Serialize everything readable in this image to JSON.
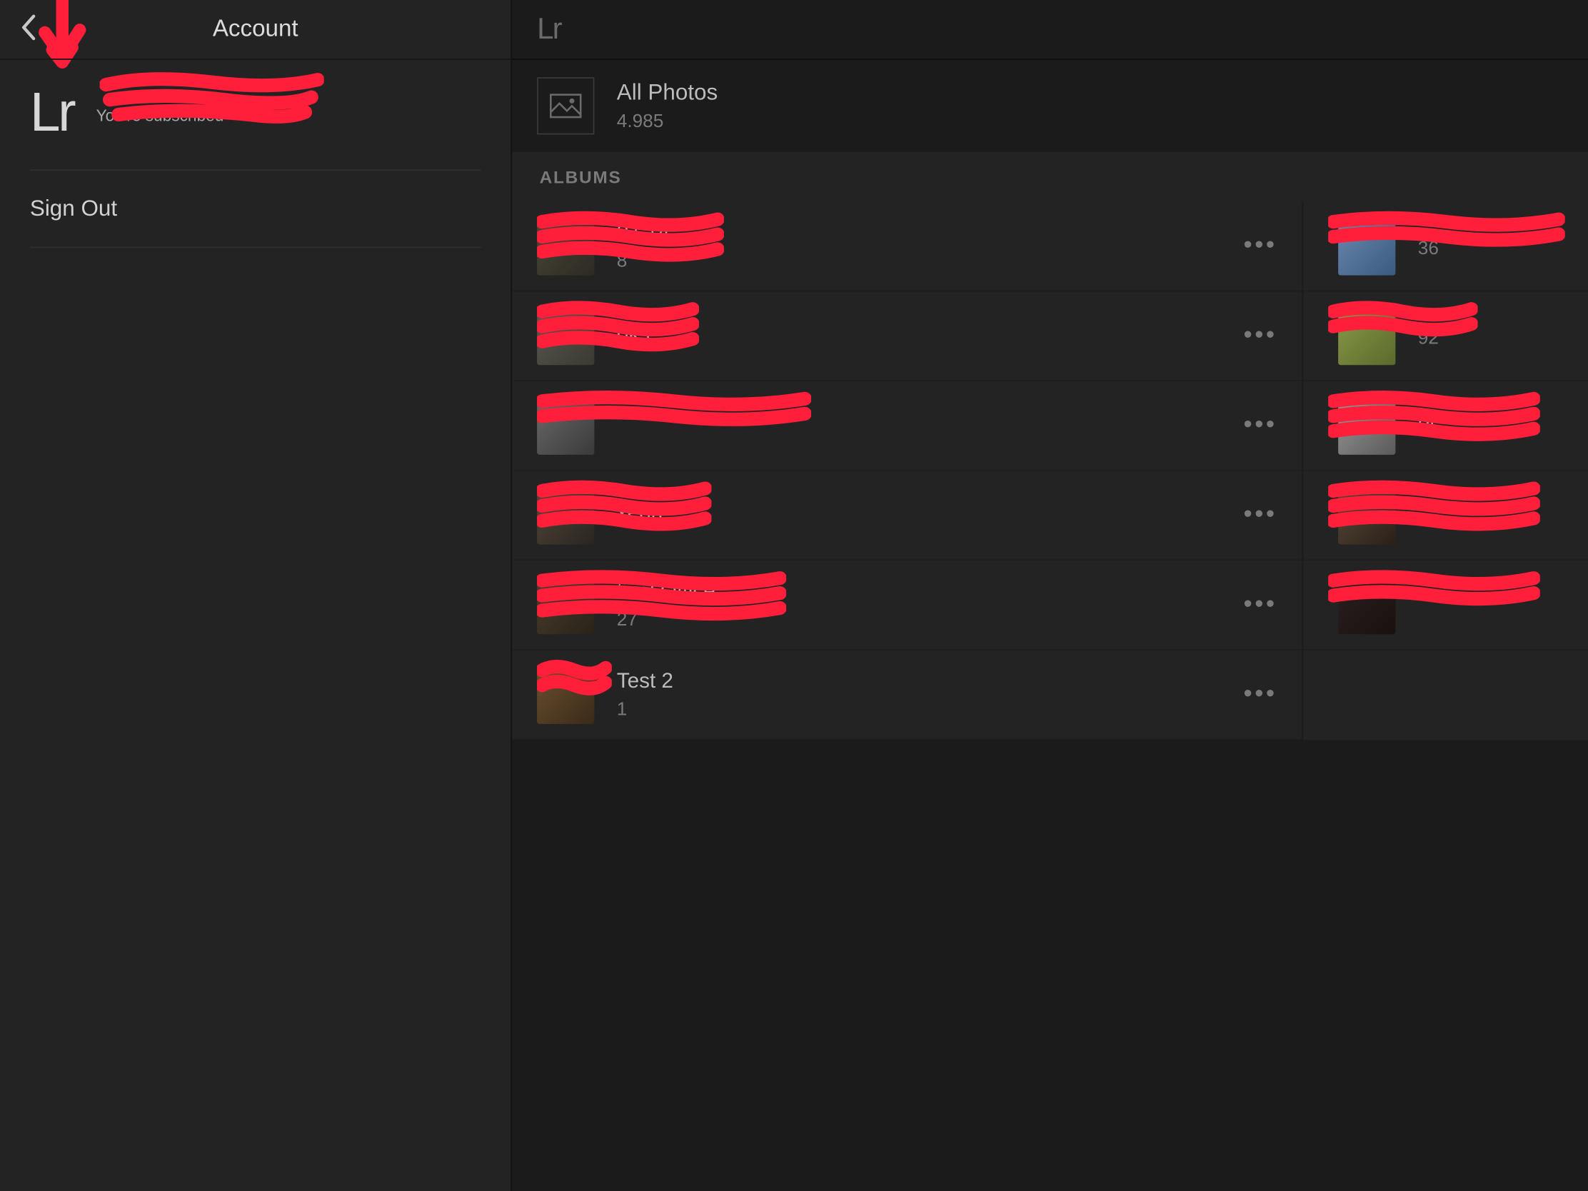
{
  "sidebar": {
    "title": "Account",
    "profile": {
      "logo": "Lr",
      "name_redacted": "",
      "sub": "You're subscribed"
    },
    "signout": "Sign Out"
  },
  "main": {
    "logo": "Lr",
    "all_photos": {
      "title": "All Photos",
      "count": "4.985"
    },
    "albums_header": "ALBUMS",
    "left_albums": [
      {
        "title": "07.14",
        "count": "8"
      },
      {
        "title": "oks",
        "count": ""
      },
      {
        "title": "",
        "count": ""
      },
      {
        "title": "xeon",
        "count": ""
      },
      {
        "title": "tical Office",
        "count": "27"
      },
      {
        "title": "Test 2",
        "count": "1"
      }
    ],
    "right_albums": [
      {
        "title": "",
        "count": "36"
      },
      {
        "title": "",
        "count": "92"
      },
      {
        "title": "er",
        "count": ""
      },
      {
        "title": "",
        "count": ""
      },
      {
        "title": "",
        "count": ""
      }
    ],
    "thumb_classes_left": [
      "thumb-a",
      "thumb-b",
      "thumb-c",
      "thumb-d",
      "thumb-e",
      "thumb-f"
    ],
    "thumb_classes_right": [
      "thumb-g",
      "thumb-h",
      "thumb-i",
      "thumb-j",
      "thumb-k"
    ]
  },
  "annotation_note": "Red hand-drawn arrow and scribble redactions overlaid on screenshot"
}
